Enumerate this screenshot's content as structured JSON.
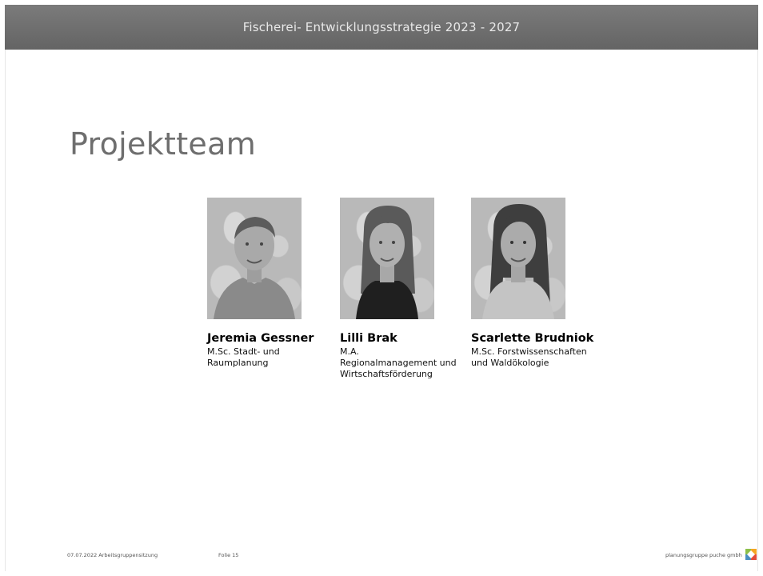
{
  "header": {
    "title": "Fischerei- Entwicklungsstrategie 2023 - 2027"
  },
  "slide": {
    "title": "Projektteam"
  },
  "team": [
    {
      "name": "Jeremia Gessner",
      "role": "M.Sc. Stadt- und\nRaumplanung"
    },
    {
      "name": "Lilli Brak",
      "role": "M.A.\nRegionalmanagement und\nWirtschaftsförderung"
    },
    {
      "name": "Scarlette Brudniok",
      "role": "M.Sc. Forstwissenschaften\nund Waldökologie"
    }
  ],
  "footer": {
    "date": "07.07.2022 Arbeitsgruppensitzung",
    "slide": "Folie 15",
    "company": "planungsgruppe puche gmbh"
  },
  "colors": {
    "header_bg": "#6f6f6f",
    "title_text": "#6e6e6e",
    "logo": [
      "#8cc04a",
      "#f5a623",
      "#4a90c2",
      "#e34b3a"
    ]
  }
}
